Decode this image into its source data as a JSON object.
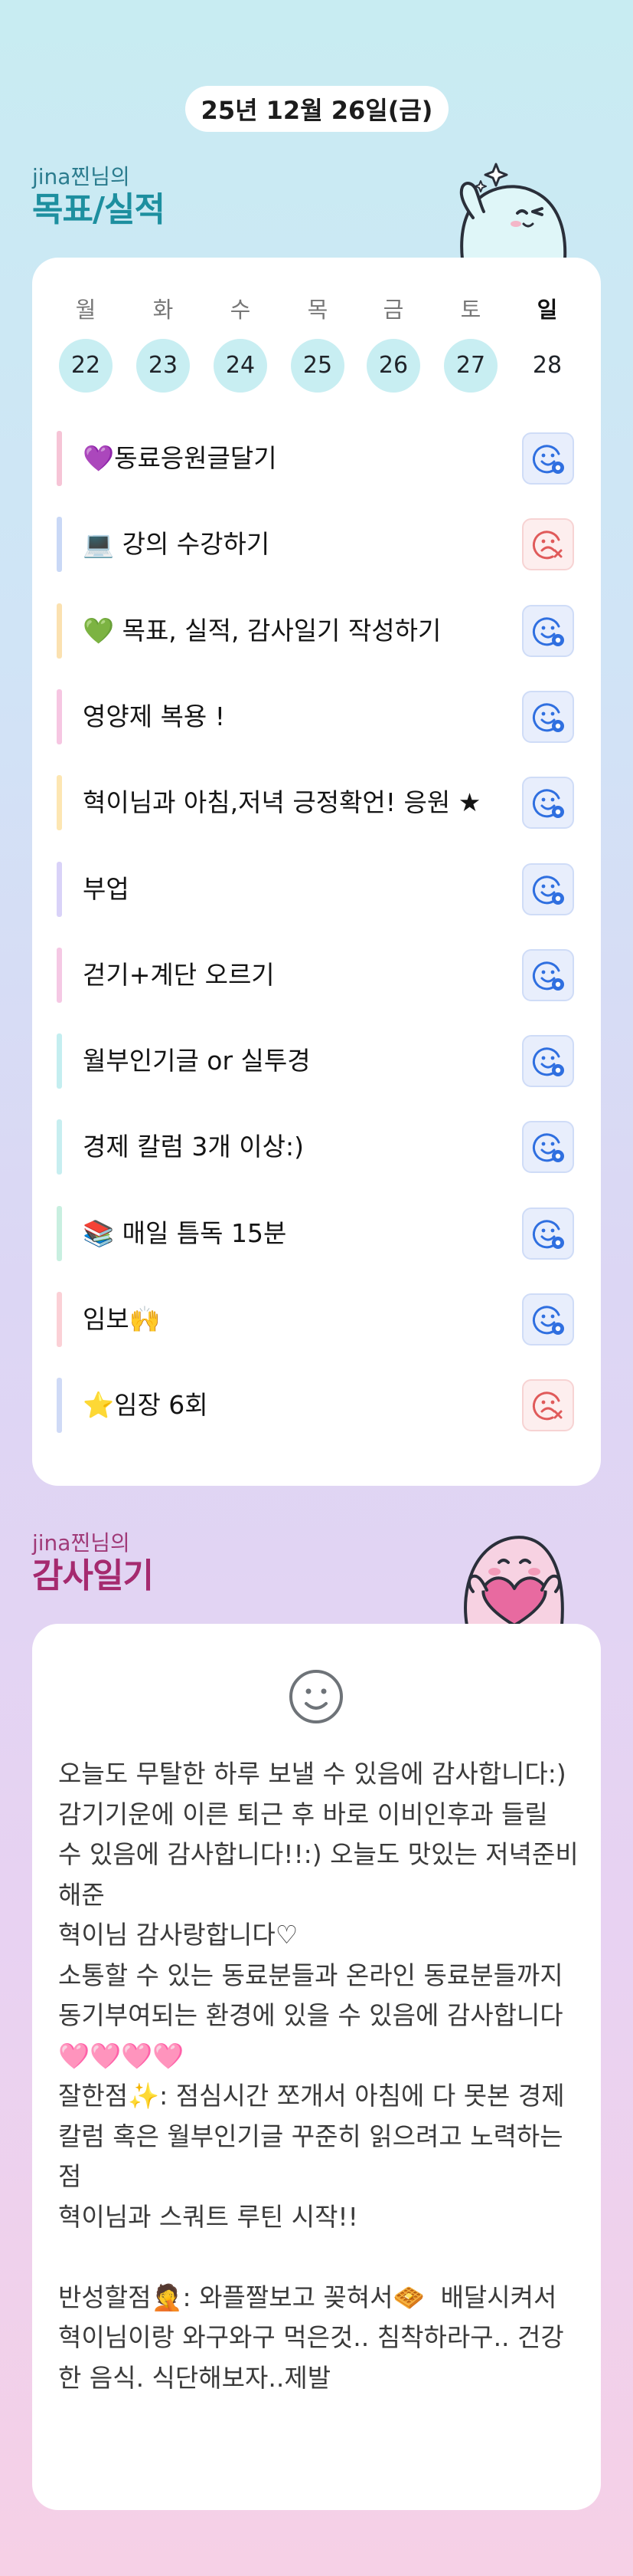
{
  "header": {
    "date": "25년 12월 26일(금)"
  },
  "goals": {
    "owner": "jina찐님의",
    "title": "목표/실적",
    "week": [
      {
        "day": "월",
        "date": "22",
        "today": false
      },
      {
        "day": "화",
        "date": "23",
        "today": false
      },
      {
        "day": "수",
        "date": "24",
        "today": false
      },
      {
        "day": "목",
        "date": "25",
        "today": false
      },
      {
        "day": "금",
        "date": "26",
        "today": false
      },
      {
        "day": "토",
        "date": "27",
        "today": false
      },
      {
        "day": "일",
        "date": "28",
        "today": true
      }
    ],
    "tasks": [
      {
        "label": "💜동료응원글달기",
        "status": "done",
        "color": "#f6c4d6"
      },
      {
        "label": "💻 강의 수강하기",
        "status": "fail",
        "color": "#c9d8f6"
      },
      {
        "label": "💚 목표, 실적, 감사일기 작성하기",
        "status": "done",
        "color": "#fbe1b0"
      },
      {
        "label": "영양제 복용 !",
        "status": "done",
        "color": "#f6c6e2"
      },
      {
        "label": "혁이님과 아침,저녁 긍정확언! 응원 ★",
        "status": "done",
        "color": "#fde6b2"
      },
      {
        "label": "부업",
        "status": "done",
        "color": "#d9d2f8"
      },
      {
        "label": "걷기+계단 오르기",
        "status": "done",
        "color": "#f5c8e4"
      },
      {
        "label": "월부인기글 or 실투경",
        "status": "done",
        "color": "#c4eef0"
      },
      {
        "label": "경제 칼럼 3개 이상:)",
        "status": "done",
        "color": "#c7eef0"
      },
      {
        "label": "📚 매일 틈독 15분",
        "status": "done",
        "color": "#c8efe0"
      },
      {
        "label": "임보🙌",
        "status": "done",
        "color": "#fbd0d6"
      },
      {
        "label": "⭐임장 6회",
        "status": "fail",
        "color": "#cfdaf6"
      }
    ]
  },
  "gratitude": {
    "owner": "jina찐님의",
    "title": "감사일기",
    "mood_icon": "smiley-icon",
    "text": "오늘도 무탈한 하루 보낼 수 있음에 감사합니다:)\n감기기운에 이른 퇴근 후 바로 이비인후과 들릴 수 있음에 감사합니다!!:) 오늘도 맛있는 저녁준비해준\n혁이님 감사랑합니다♡\n소통할 수 있는 동료분들과 온라인 동료분들까지\n동기부여되는 환경에 있을 수 있음에 감사합니다🩷🩷🩷🩷\n잘한점✨: 점심시간 쪼개서 아침에 다 못본 경제칼럼 혹은 월부인기글 꾸준히 읽으려고 노력하는점\n혁이님과 스쿼트 루틴 시작!!\n\n반성할점🤦: 와플짤보고 꽂혀서🧇  배달시켜서 혁이님이랑 와구와구 먹은것.. 침착하라구.. 건강한 음식. 식단해보자..제발"
  },
  "colors": {
    "goals_accent": "#1d8f9f",
    "grat_accent": "#a52a6f",
    "done_icon": "#2f6fe0",
    "fail_icon": "#e05a5a"
  }
}
